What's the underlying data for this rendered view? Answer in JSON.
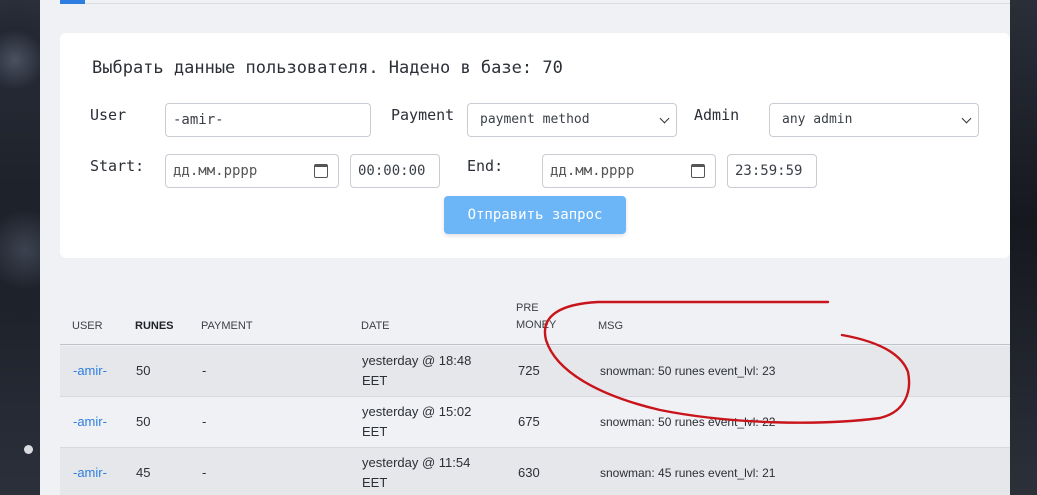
{
  "form": {
    "title": "Выбрать данные пользователя. Надено в базе: 70",
    "user_label": "User",
    "user_value": "-amir-",
    "payment_label": "Payment",
    "payment_selected": "payment method",
    "admin_label": "Admin",
    "admin_selected": "any admin",
    "start_label": "Start:",
    "start_date_placeholder": "дд.мм.рррр",
    "start_time": "00:00:00",
    "end_label": "End:",
    "end_date_placeholder": "дд.мм.рррр",
    "end_time": "23:59:59",
    "submit_label": "Отправить запрос"
  },
  "table": {
    "headers": {
      "user": "USER",
      "runes": "RUNES",
      "payment": "PAYMENT",
      "date": "DATE",
      "pre_money_1": "PRE",
      "pre_money_2": "MONEY",
      "msg": "MSG"
    },
    "rows": [
      {
        "user": "-amir-",
        "runes": "50",
        "payment": "-",
        "date_1": "yesterday @ 18:48",
        "date_2": "EET",
        "pre_money": "725",
        "msg": "snowman: 50 runes event_lvl: 23"
      },
      {
        "user": "-amir-",
        "runes": "50",
        "payment": "-",
        "date_1": "yesterday @ 15:02",
        "date_2": "EET",
        "pre_money": "675",
        "msg": "snowman: 50 runes event_lvl: 22"
      },
      {
        "user": "-amir-",
        "runes": "45",
        "payment": "-",
        "date_1": "yesterday @ 11:54",
        "date_2": "EET",
        "pre_money": "630",
        "msg": "snowman: 45 runes event_lvl: 21"
      }
    ]
  },
  "colors": {
    "accent": "#2d7ee0",
    "button": "#6cb6f8",
    "annotation": "#c8141b"
  }
}
